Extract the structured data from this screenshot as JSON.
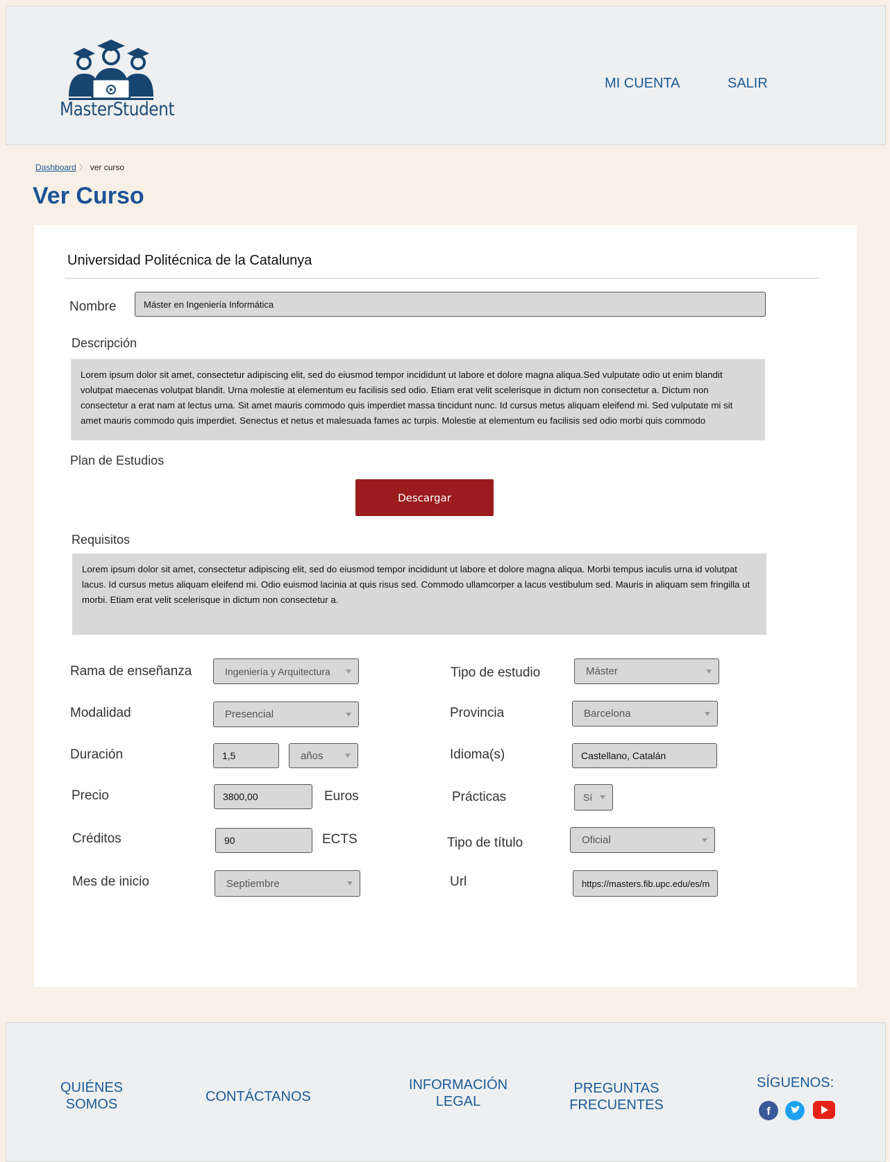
{
  "header": {
    "logo_text": "MasterStudent",
    "nav": {
      "account": "MI CUENTA",
      "logout": "SALIR"
    }
  },
  "breadcrumb": {
    "home": "Dashboard",
    "current": "ver curso"
  },
  "page_title": "Ver Curso",
  "course": {
    "university": "Universidad Politécnica de la Catalunya",
    "name_label": "Nombre",
    "name_value": "Máster en Ingeniería Informática",
    "description_label": "Descripción",
    "description": "Lorem ipsum dolor sit amet, consectetur adipiscing elit, sed do eiusmod tempor incididunt ut labore et dolore magna aliqua.Sed vulputate odio ut enim blandit volutpat maecenas volutpat blandit. Urna molestie at elementum eu facilisis sed odio. Etiam erat velit scelerisque in dictum non consectetur a. Dictum non consectetur a erat nam at lectus urna. Sit amet mauris commodo quis imperdiet massa tincidunt nunc. Id cursus metus aliquam eleifend mi. Sed vulputate mi sit amet mauris commodo quis imperdiet. Senectus et netus et malesuada fames ac turpis. Molestie at elementum eu facilisis sed odio morbi quis commodo",
    "plan_label": "Plan de Estudios",
    "download_button": "Descargar",
    "requirements_label": "Requisitos",
    "requirements": "Lorem ipsum dolor sit amet, consectetur adipiscing elit, sed do eiusmod tempor incididunt ut labore et dolore magna aliqua. Morbi tempus iaculis urna id volutpat lacus. Id cursus metus aliquam eleifend mi. Odio euismod lacinia at quis risus sed. Commodo ullamcorper a lacus vestibulum sed. Mauris in aliquam sem fringilla ut morbi. Etiam erat velit scelerisque in dictum non consectetur a."
  },
  "fields": {
    "rama": {
      "label": "Rama de enseñanza",
      "value": "Ingeniería y Arquitectura"
    },
    "tipo_estudio": {
      "label": "Tipo de estudio",
      "value": "Máster"
    },
    "modalidad": {
      "label": "Modalidad",
      "value": "Presencial"
    },
    "provincia": {
      "label": "Provincia",
      "value": "Barcelona"
    },
    "duracion": {
      "label": "Duración",
      "value": "1,5",
      "unit": "años"
    },
    "idioma": {
      "label": "Idioma(s)",
      "value": "Castellano, Catalán"
    },
    "precio": {
      "label": "Precio",
      "value": "3800,00",
      "unit": "Euros"
    },
    "practicas": {
      "label": "Prácticas",
      "value": "Sí"
    },
    "creditos": {
      "label": "Créditos",
      "value": "90",
      "unit": "ECTS"
    },
    "tipo_titulo": {
      "label": "Tipo de título",
      "value": "Oficial"
    },
    "mes_inicio": {
      "label": "Mes de inicio",
      "value": "Septiembre"
    },
    "url": {
      "label": "Url",
      "value": "https://masters.fib.upc.edu/es/m"
    }
  },
  "footer": {
    "about": "QUIÉNES SOMOS",
    "contact": "CONTÁCTANOS",
    "legal": "INFORMACIÓN LEGAL",
    "faq": "PREGUNTAS FRECUENTES",
    "follow": "SÍGUENOS:",
    "social_icons": [
      "facebook-icon",
      "twitter-icon",
      "youtube-icon"
    ],
    "social_colors": {
      "facebook": "#3b5998",
      "twitter": "#1da1f2",
      "youtube": "#e62117"
    }
  },
  "colors": {
    "accent": "#1b5296",
    "button": "#9b1b1e",
    "background": "#f8f0e6"
  }
}
